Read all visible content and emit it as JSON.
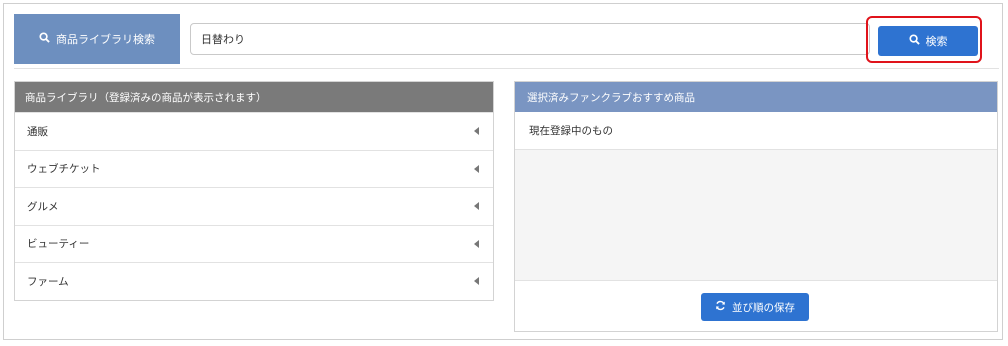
{
  "search": {
    "label": "商品ライブラリ検索",
    "query": "日替わり",
    "button_label": "検索",
    "highlight_color": "#e0131b"
  },
  "library": {
    "title": "商品ライブラリ（登録済みの商品が表示されます）",
    "items": [
      {
        "label": "通販"
      },
      {
        "label": "ウェブチケット"
      },
      {
        "label": "グルメ"
      },
      {
        "label": "ビューティー"
      },
      {
        "label": "ファーム"
      }
    ]
  },
  "recommend": {
    "title": "選択済みファンクラブおすすめ商品",
    "current_label": "現在登録中のもの",
    "save_button_label": "並び順の保存"
  },
  "icons": {
    "search": "search-icon",
    "refresh": "refresh-icon",
    "expand": "caret-left-icon"
  },
  "colors": {
    "accent": "#2e73d1",
    "label_bg": "#6d8fbf",
    "library_header_bg": "#7a7a7a",
    "recommend_header_bg": "#7a95c2"
  }
}
